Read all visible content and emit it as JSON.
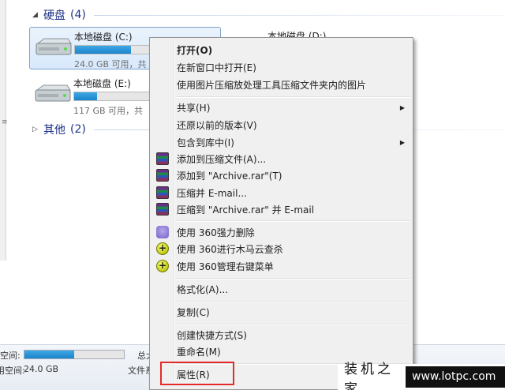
{
  "explorer": {
    "groups": {
      "hard_disks": {
        "label": "硬盘",
        "count": "(4)"
      },
      "other": {
        "label": "其他",
        "count": "(2)"
      }
    },
    "drives": {
      "c": {
        "name": "本地磁盘 (C:)",
        "info": "24.0 GB 可用，共",
        "used_fraction": 0.72
      },
      "d": {
        "name": "本地磁盘 (D:)"
      },
      "e": {
        "name": "本地磁盘 (E:)",
        "info": "117 GB 可用，共",
        "used_fraction": 0.3
      }
    }
  },
  "status_bar": {
    "space_label": "空间:",
    "free_label": "可用空间:",
    "free_value": "24.0 GB",
    "total_label": "总大",
    "fs_label": "文件系",
    "used_fraction": 0.5
  },
  "context_menu": {
    "items": [
      {
        "label": "打开(O)",
        "bold": true
      },
      {
        "label": "在新窗口中打开(E)"
      },
      {
        "label": "使用图片压缩放处理工具压缩文件夹内的图片"
      },
      {
        "label": "共享(H)",
        "submenu": true
      },
      {
        "label": "还原以前的版本(V)"
      },
      {
        "label": "包含到库中(I)",
        "submenu": true
      },
      {
        "label": "添加到压缩文件(A)...",
        "icon": "winrar-icon"
      },
      {
        "label": "添加到 \"Archive.rar\"(T)",
        "icon": "winrar-icon"
      },
      {
        "label": "压缩并 E-mail...",
        "icon": "winrar-icon"
      },
      {
        "label": "压缩到 \"Archive.rar\" 并 E-mail",
        "icon": "winrar-icon"
      },
      {
        "label": "使用 360强力删除",
        "icon": "eraser-icon"
      },
      {
        "label": "使用 360进行木马云查杀",
        "icon": "shield-360-icon"
      },
      {
        "label": "使用 360管理右键菜单",
        "icon": "shield-360-icon"
      },
      {
        "label": "格式化(A)..."
      },
      {
        "label": "复制(C)"
      },
      {
        "label": "创建快捷方式(S)"
      },
      {
        "label": "重命名(M)"
      },
      {
        "label": "属性(R)",
        "highlighted": true
      }
    ]
  },
  "watermark": {
    "cn": "装机之家",
    "url": "www.lotpc.com"
  },
  "colors": {
    "highlight_border": "#e32b2b",
    "group_header": "#1e3287",
    "drive_fill": "#1a84cc"
  }
}
